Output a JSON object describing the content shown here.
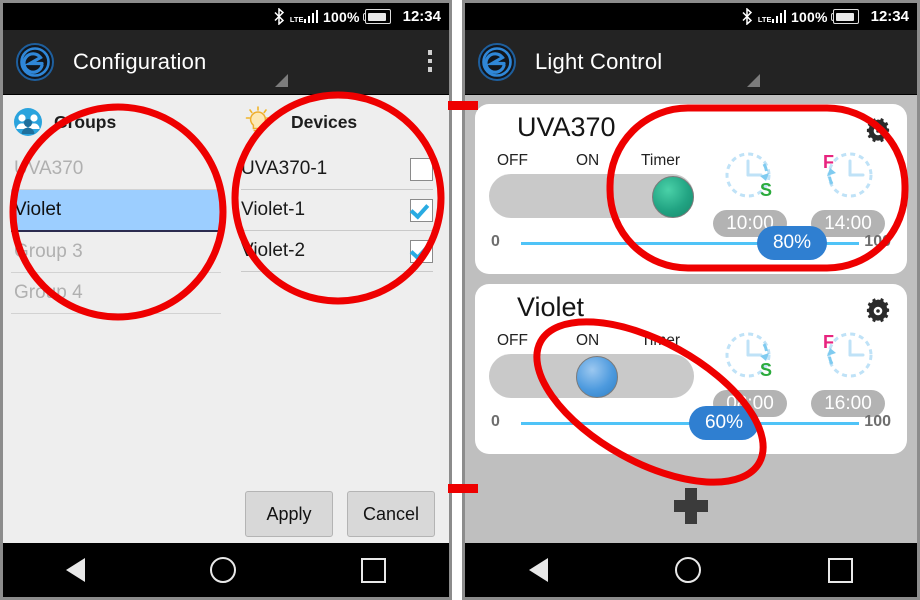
{
  "status_bar": {
    "bluetooth_icon": "bluetooth-icon",
    "network_label": "LTE",
    "battery_text": "100%",
    "time": "12:34"
  },
  "left_screen": {
    "app_icon": "app-logo-e-icon",
    "title": "Configuration",
    "overflow_icon": "overflow-menu-icon",
    "groups_panel": {
      "icon": "groups-people-icon",
      "header": "Groups",
      "items": [
        {
          "label": "UVA370",
          "selected": false
        },
        {
          "label": "Violet",
          "selected": true
        },
        {
          "label": "Group 3",
          "selected": false
        },
        {
          "label": "Group 4",
          "selected": false
        }
      ]
    },
    "devices_panel": {
      "icon": "lightbulb-icon",
      "header": "Devices",
      "items": [
        {
          "label": "UVA370-1",
          "checked": false
        },
        {
          "label": "Violet-1",
          "checked": true
        },
        {
          "label": "Violet-2",
          "checked": true
        }
      ]
    },
    "buttons": {
      "apply": "Apply",
      "cancel": "Cancel"
    }
  },
  "right_screen": {
    "app_icon": "app-logo-e-icon",
    "title": "Light Control",
    "add_icon": "add-plus-icon",
    "cards": [
      {
        "name": "UVA370",
        "gear_icon": "gear-icon",
        "switch": {
          "labels": [
            "OFF",
            "ON",
            "Timer"
          ],
          "position": "Timer",
          "knob_color": "#22a483"
        },
        "start_clock": {
          "icon": "clock-start-icon",
          "badge": "S",
          "time": "10:00"
        },
        "finish_clock": {
          "icon": "clock-finish-icon",
          "badge": "F",
          "time": "14:00"
        },
        "slider": {
          "min": "0",
          "max": "100",
          "value": "80%",
          "percent": 80
        }
      },
      {
        "name": "Violet",
        "gear_icon": "gear-icon",
        "switch": {
          "labels": [
            "OFF",
            "ON",
            "Timer"
          ],
          "position": "ON",
          "knob_color": "#4d9ade"
        },
        "start_clock": {
          "icon": "clock-start-icon",
          "badge": "S",
          "time": "08:00"
        },
        "finish_clock": {
          "icon": "clock-finish-icon",
          "badge": "F",
          "time": "16:00"
        },
        "slider": {
          "min": "0",
          "max": "100",
          "value": "60%",
          "percent": 60
        }
      }
    ]
  },
  "nav_bar": {
    "back_icon": "back-triangle-icon",
    "home_icon": "home-circle-icon",
    "recents_icon": "recents-square-icon"
  },
  "annotations": {
    "color": "#ee0000",
    "shapes": [
      "circle-groups",
      "circle-devices",
      "rounded-rect-timer",
      "oval-on-slider",
      "connector-top",
      "connector-bottom"
    ]
  }
}
